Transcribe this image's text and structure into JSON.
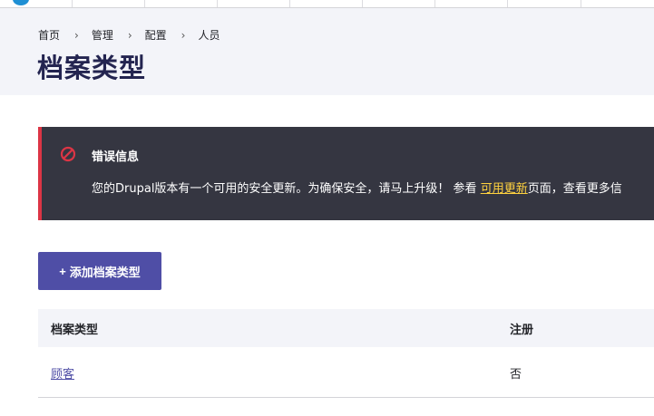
{
  "breadcrumb": {
    "items": [
      "首页",
      "管理",
      "配置",
      "人员"
    ],
    "separator": "›"
  },
  "page": {
    "title": "档案类型"
  },
  "alert": {
    "title": "错误信息",
    "body_before": "您的Drupal版本有一个可用的安全更新。为确保安全，请马上升级！ 参看 ",
    "link_text": "可用更新",
    "body_after": "页面，查看更多信",
    "icon": "error-circle-icon"
  },
  "actions": {
    "add_label": "添加档案类型",
    "add_icon": "+"
  },
  "table": {
    "columns": [
      "档案类型",
      "注册"
    ],
    "rows": [
      {
        "type": "顾客",
        "registration": "否"
      }
    ]
  },
  "colors": {
    "accent": "#4f4ea6",
    "title": "#232450",
    "alert_bg": "#353641",
    "alert_border": "#dc3545",
    "link_highlight": "#ffd23f"
  }
}
